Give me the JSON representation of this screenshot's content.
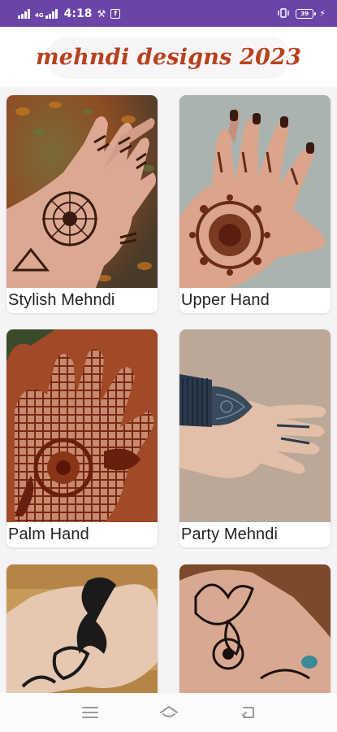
{
  "status_bar": {
    "network_label": "4G",
    "time": "4:18",
    "battery_level": "39",
    "colors": {
      "background": "#6a45a8"
    }
  },
  "header": {
    "title": "mehndi designs 2023",
    "title_color": "#b7421d"
  },
  "categories": [
    {
      "label": "Stylish Mehndi",
      "image": "stylish-mehndi-hand-photo"
    },
    {
      "label": "Upper Hand",
      "image": "upper-hand-mehndi-photo"
    },
    {
      "label": "Palm Hand",
      "image": "palm-hand-mehndi-photo"
    },
    {
      "label": "Party Mehndi",
      "image": "party-mehndi-photo"
    },
    {
      "label": "",
      "image": "hand-mehndi-photo-5"
    },
    {
      "label": "",
      "image": "butterfly-mehndi-photo-6"
    }
  ],
  "nav_bar": {
    "buttons": [
      "menu-icon",
      "home-icon",
      "back-icon"
    ]
  }
}
